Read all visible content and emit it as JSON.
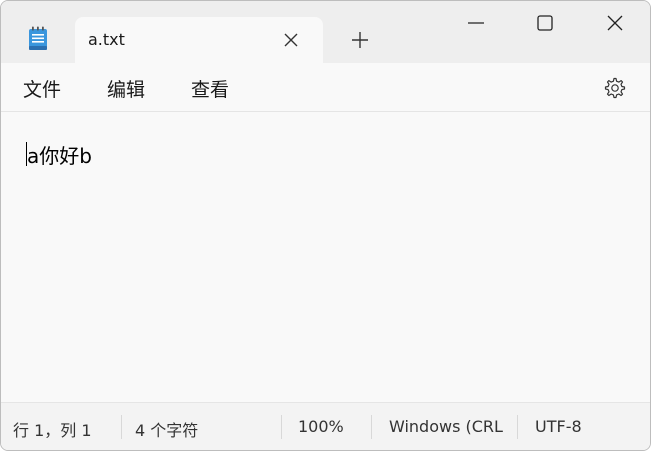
{
  "tab": {
    "title": "a.txt",
    "close_icon": "close-icon",
    "new_tab_icon": "plus-icon"
  },
  "app_icon": "notepad-icon",
  "window_controls": {
    "minimize_icon": "minimize-icon",
    "maximize_icon": "maximize-icon",
    "close_icon": "close-icon"
  },
  "menu": {
    "file": "文件",
    "edit": "编辑",
    "view": "查看",
    "settings_icon": "gear-icon"
  },
  "editor": {
    "content": "a你好b"
  },
  "status": {
    "position": "行 1，列 1",
    "char_count": "4 个字符",
    "zoom": "100%",
    "line_ending": "Windows (CRL",
    "encoding": "UTF-8"
  },
  "colors": {
    "titlebar_bg": "#eeeeee",
    "content_bg": "#f9f9f9",
    "statusbar_bg": "#f3f3f3",
    "icon_blue": "#2b88d8"
  }
}
